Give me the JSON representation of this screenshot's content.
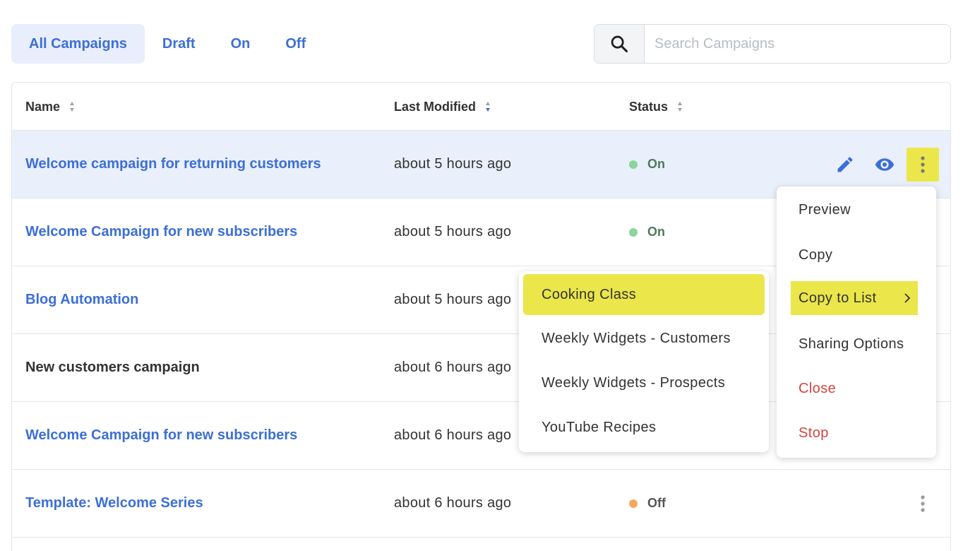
{
  "filters": {
    "tabs": [
      {
        "label": "All Campaigns",
        "active": true
      },
      {
        "label": "Draft",
        "active": false
      },
      {
        "label": "On",
        "active": false
      },
      {
        "label": "Off",
        "active": false
      }
    ]
  },
  "search": {
    "placeholder": "Search Campaigns",
    "value": "",
    "icon": "search-icon"
  },
  "table": {
    "columns": {
      "name": "Name",
      "modified": "Last Modified",
      "status": "Status"
    },
    "rows": [
      {
        "name": "Welcome campaign for returning customers",
        "modified": "about 5 hours ago",
        "status": "On",
        "status_color": "#8bd49c"
      },
      {
        "name": "Welcome Campaign for new subscribers",
        "modified": "about 5 hours ago",
        "status": "On",
        "status_color": "#8bd49c"
      },
      {
        "name": "Blog Automation",
        "modified": "about 5 hours ago",
        "status": "",
        "status_color": ""
      },
      {
        "name": "New customers campaign",
        "modified": "about 6 hours ago",
        "status": "",
        "status_color": ""
      },
      {
        "name": "Welcome Campaign for new subscribers",
        "modified": "about 6 hours ago",
        "status": "",
        "status_color": ""
      },
      {
        "name": "Template: Welcome Series",
        "modified": "about 6 hours ago",
        "status": "Off",
        "status_color": "#f5a85c"
      }
    ]
  },
  "context_menu": {
    "items": [
      "Preview",
      "Copy",
      "Copy to List",
      "Sharing Options",
      "Close",
      "Stop"
    ]
  },
  "submenu": {
    "items": [
      "Cooking Class",
      "Weekly Widgets - Customers",
      "Weekly Widgets - Prospects",
      "YouTube Recipes"
    ]
  },
  "colors": {
    "accent": "#3c6fd6",
    "highlight": "#ebe64a",
    "on": "#8bd49c",
    "off": "#f5a85c",
    "danger": "#d0453f"
  }
}
